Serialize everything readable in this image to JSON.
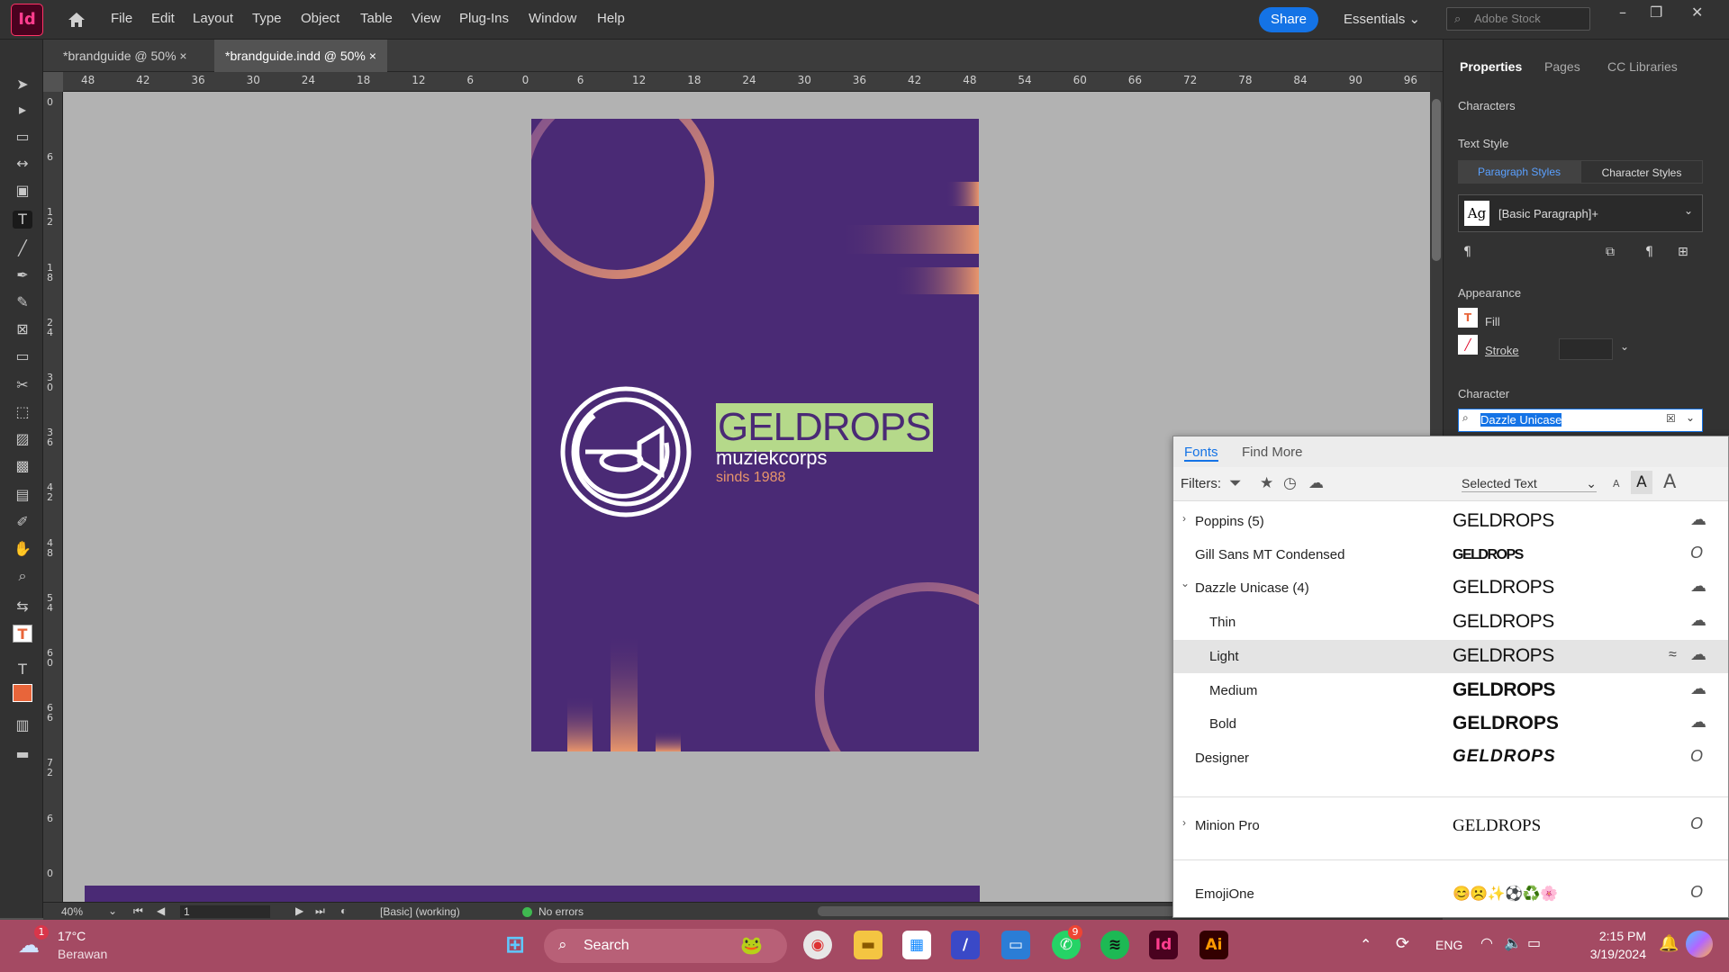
{
  "app": {
    "logo": "Id"
  },
  "menu": [
    "File",
    "Edit",
    "Layout",
    "Type",
    "Object",
    "Table",
    "View",
    "Plug-Ins",
    "Window",
    "Help"
  ],
  "share_label": "Share",
  "workspace": "Essentials",
  "stock_placeholder": "Adobe Stock",
  "tabs": [
    {
      "label": "*brandguide @ 50%",
      "close": "×",
      "active": false
    },
    {
      "label": "*brandguide.indd @ 50%",
      "close": "×",
      "active": true
    }
  ],
  "ruler_top": [
    "48",
    "42",
    "36",
    "30",
    "24",
    "18",
    "12",
    "6",
    "0",
    "6",
    "12",
    "18",
    "24",
    "30",
    "36",
    "42",
    "48",
    "54",
    "60",
    "66",
    "72",
    "78",
    "84",
    "90",
    "96"
  ],
  "ruler_left": [
    "0",
    "6",
    "12",
    "18",
    "24",
    "30",
    "36",
    "42",
    "48",
    "54",
    "60",
    "66",
    "72",
    "6",
    "0"
  ],
  "document": {
    "brand_name": "GELDROPS",
    "subtitle": "muziekcorps",
    "since": "sinds 1988",
    "colors": {
      "background": "#4a2a75",
      "accent": "#e8956b",
      "highlight": "#b5d98a"
    }
  },
  "status": {
    "zoom": "40%",
    "page": "1",
    "style": "[Basic] (working)",
    "errors": "No errors"
  },
  "panel": {
    "tabs": [
      "Properties",
      "Pages",
      "CC Libraries"
    ],
    "section_characters": "Characters",
    "text_style": "Text Style",
    "paragraph_styles": "Paragraph Styles",
    "character_styles": "Character Styles",
    "style_sample": "Ag",
    "paragraph_style_value": "[Basic Paragraph]+",
    "appearance": "Appearance",
    "fill": "Fill",
    "stroke": "Stroke",
    "character": "Character",
    "font_search": "Dazzle Unicase"
  },
  "font_popup": {
    "tabs": [
      "Fonts",
      "Find More"
    ],
    "filters_label": "Filters:",
    "preview_mode": "Selected Text",
    "sample": "GELDROPS",
    "rows": [
      {
        "name": "Poppins (5)",
        "expander": "›",
        "sample": "GELDROPS",
        "status": "cloud"
      },
      {
        "name": "Gill Sans MT Condensed",
        "expander": "",
        "sample": "GELDROPS",
        "status": "O"
      },
      {
        "name": "Dazzle Unicase (4)",
        "expander": "⌄",
        "sample": "GELDROPS",
        "status": "cloud"
      },
      {
        "name": "Thin",
        "expander": "",
        "sample": "GELDROPS",
        "status": "cloud"
      },
      {
        "name": "Light",
        "expander": "",
        "sample": "GELDROPS",
        "status": "cloud"
      },
      {
        "name": "Medium",
        "expander": "",
        "sample": "GELDROPS",
        "status": "cloud"
      },
      {
        "name": "Bold",
        "expander": "",
        "sample": "GELDROPS",
        "status": "cloud"
      },
      {
        "name": "Designer",
        "expander": "",
        "sample": "GELDROPS",
        "status": "O"
      },
      {
        "name": "Minion Pro",
        "expander": "›",
        "sample": "GELDROPS",
        "status": "O"
      },
      {
        "name": "EmojiOne",
        "expander": "",
        "sample": "😊☹️✨⚽♻️🌸",
        "status": "O"
      }
    ]
  },
  "taskbar": {
    "weather_temp": "17°C",
    "weather_place": "Berawan",
    "weather_badge": "1",
    "search": "Search",
    "whatsapp_badge": "9",
    "lang": "ENG",
    "time": "2:15 PM",
    "date": "3/19/2024"
  }
}
